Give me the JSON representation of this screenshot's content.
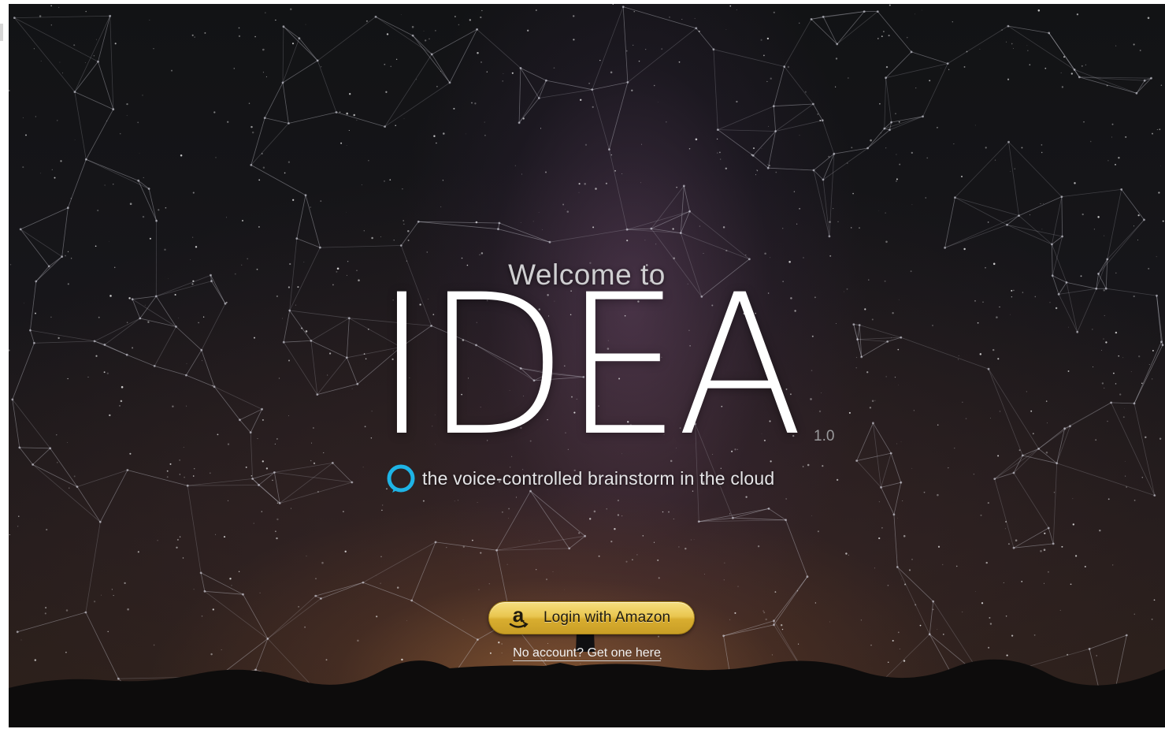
{
  "hero": {
    "welcome": "Welcome to",
    "brand": "IDEA",
    "version": "1.0",
    "tagline": "the voice-controlled brainstorm in the cloud"
  },
  "login": {
    "button_label": "Login with Amazon",
    "signup_link": "No account? Get one here"
  },
  "icons": {
    "assistant": "alexa-ring-icon",
    "amazon": "amazon-logo-icon"
  },
  "colors": {
    "accent_alexa": "#1eb4e6",
    "button_gold": "#e9c650",
    "text": "#ffffff"
  }
}
